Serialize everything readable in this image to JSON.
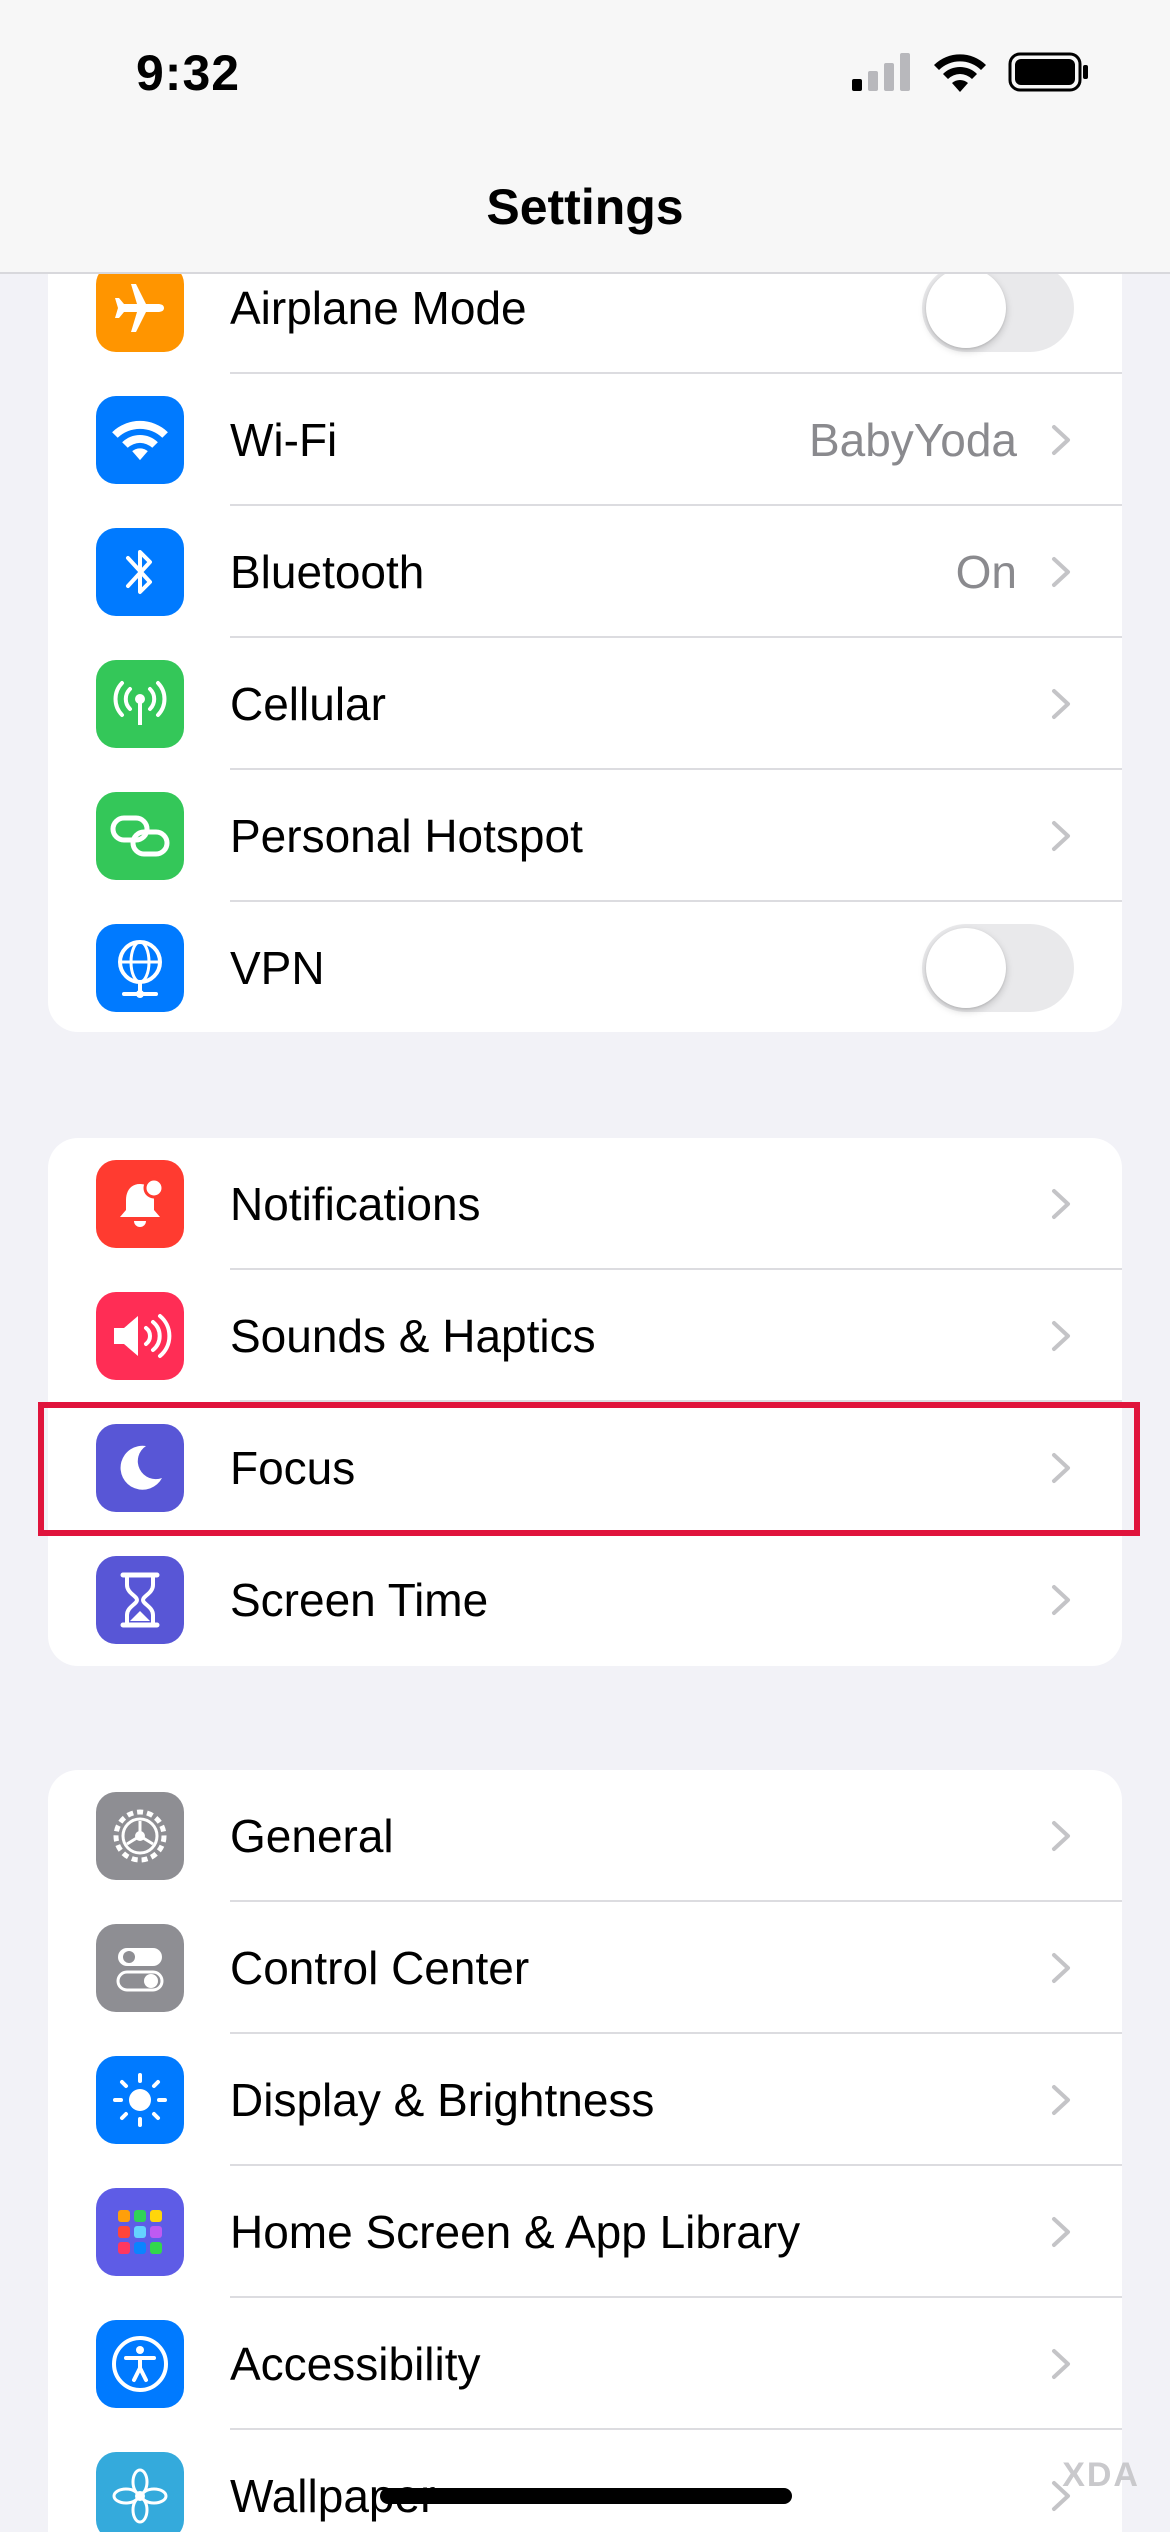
{
  "status_bar": {
    "time": "9:32",
    "icons": [
      "cellular-signal-icon",
      "wifi-icon",
      "battery-icon"
    ]
  },
  "nav": {
    "title": "Settings"
  },
  "groups": [
    {
      "rows": [
        {
          "label": "Airplane Mode",
          "icon": "airplane-icon",
          "icon_color": "#ff9500",
          "accessory": "toggle",
          "toggle_on": false
        },
        {
          "label": "Wi-Fi",
          "icon": "wifi-icon",
          "icon_color": "#007aff",
          "value": "BabyYoda",
          "accessory": "chevron"
        },
        {
          "label": "Bluetooth",
          "icon": "bluetooth-icon",
          "icon_color": "#007aff",
          "value": "On",
          "accessory": "chevron"
        },
        {
          "label": "Cellular",
          "icon": "antenna-icon",
          "icon_color": "#34c759",
          "accessory": "chevron"
        },
        {
          "label": "Personal Hotspot",
          "icon": "link-icon",
          "icon_color": "#34c759",
          "accessory": "chevron"
        },
        {
          "label": "VPN",
          "icon": "globe-icon",
          "icon_color": "#007aff",
          "accessory": "toggle",
          "toggle_on": false
        }
      ]
    },
    {
      "rows": [
        {
          "label": "Notifications",
          "icon": "bell-icon",
          "icon_color": "#ff3b30",
          "accessory": "chevron"
        },
        {
          "label": "Sounds & Haptics",
          "icon": "speaker-icon",
          "icon_color": "#ff2d55",
          "accessory": "chevron"
        },
        {
          "label": "Focus",
          "icon": "moon-icon",
          "icon_color": "#5856d6",
          "accessory": "chevron",
          "highlighted": true
        },
        {
          "label": "Screen Time",
          "icon": "hourglass-icon",
          "icon_color": "#5856d6",
          "accessory": "chevron"
        }
      ]
    },
    {
      "rows": [
        {
          "label": "General",
          "icon": "gear-icon",
          "icon_color": "#8e8e93",
          "accessory": "chevron"
        },
        {
          "label": "Control Center",
          "icon": "switches-icon",
          "icon_color": "#8e8e93",
          "accessory": "chevron"
        },
        {
          "label": "Display & Brightness",
          "icon": "sun-icon",
          "icon_color": "#007aff",
          "accessory": "chevron"
        },
        {
          "label": "Home Screen & App Library",
          "icon": "app-grid-icon",
          "icon_color": "#5e5ce6",
          "accessory": "chevron"
        },
        {
          "label": "Accessibility",
          "icon": "accessibility-icon",
          "icon_color": "#007aff",
          "accessory": "chevron"
        },
        {
          "label": "Wallpaper",
          "icon": "flower-icon",
          "icon_color": "#34aadc",
          "accessory": "chevron"
        }
      ]
    }
  ],
  "watermark": "XDA",
  "highlight_color": "#e0143c"
}
